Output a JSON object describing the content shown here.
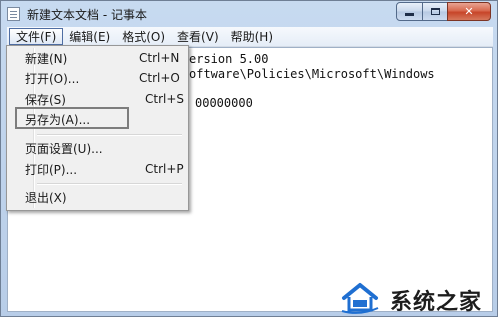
{
  "window": {
    "title": "新建文本文档 - 记事本"
  },
  "menubar": {
    "items": [
      "文件(F)",
      "编辑(E)",
      "格式(O)",
      "查看(V)",
      "帮助(H)"
    ]
  },
  "file_menu": {
    "items": [
      {
        "label": "新建(N)",
        "shortcut": "Ctrl+N"
      },
      {
        "label": "打开(O)...",
        "shortcut": "Ctrl+O"
      },
      {
        "label": "保存(S)",
        "shortcut": "Ctrl+S"
      },
      {
        "label": "另存为(A)...",
        "shortcut": ""
      },
      {
        "label": "页面设置(U)...",
        "shortcut": ""
      },
      {
        "label": "打印(P)...",
        "shortcut": "Ctrl+P"
      },
      {
        "label": "退出(X)",
        "shortcut": ""
      }
    ]
  },
  "editor": {
    "lines": [
      "ersion 5.00",
      "oftware\\Policies\\Microsoft\\Windows",
      "",
      "00000000"
    ]
  },
  "watermark": {
    "text": "系统之家"
  },
  "colors": {
    "title_bar": "#b8cde8",
    "close_button": "#c74529",
    "menu_active_border": "#4f6ea3",
    "highlight_box": "#7d7d7d",
    "watermark_blue": "#1f6fd1"
  }
}
